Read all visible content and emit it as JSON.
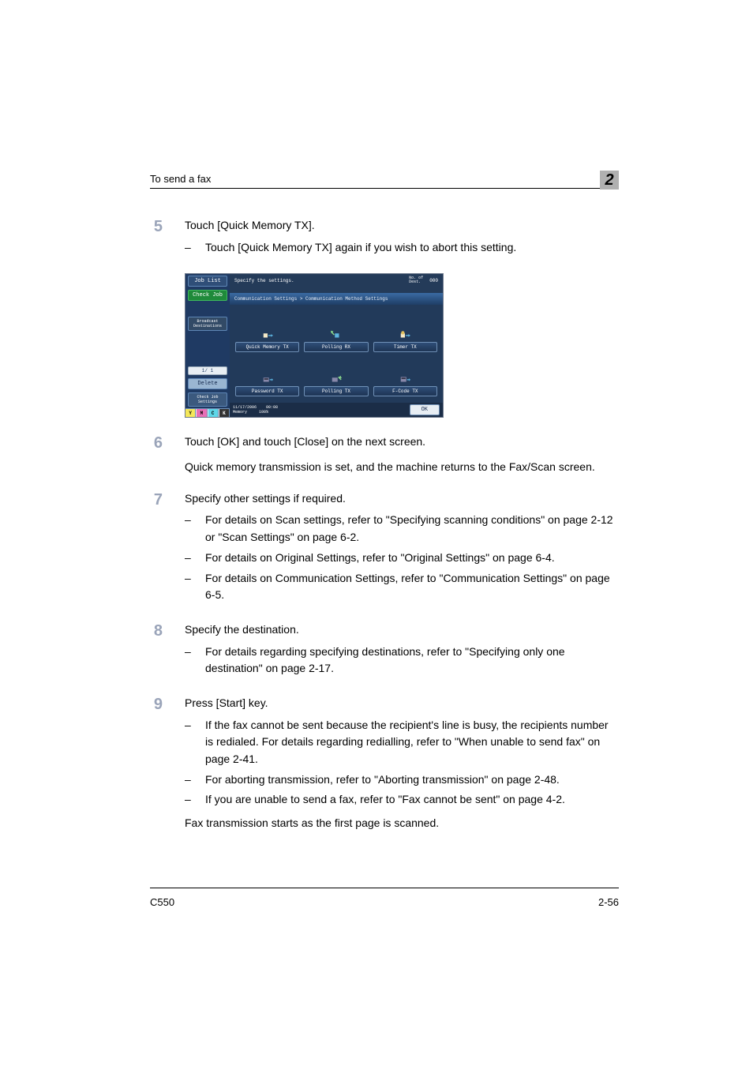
{
  "header": {
    "title": "To send a fax",
    "chapter": "2"
  },
  "footer": {
    "model": "C550",
    "page": "2-56"
  },
  "steps": [
    {
      "n": "5",
      "text": "Touch [Quick Memory TX].",
      "bullets": [
        "Touch [Quick Memory TX] again if you wish to abort this setting."
      ]
    },
    {
      "n": "6",
      "text": "Touch [OK] and touch [Close] on the next screen.",
      "para2": "Quick memory transmission is set, and the machine returns to the Fax/Scan screen."
    },
    {
      "n": "7",
      "text": "Specify other settings if required.",
      "bullets": [
        "For details on Scan settings, refer to \"Specifying scanning conditions\" on page 2-12 or \"Scan Settings\" on page 6-2.",
        "For details on Original Settings, refer to \"Original Settings\" on page 6-4.",
        "For details on Communication Settings, refer to \"Communication Settings\" on page 6-5."
      ]
    },
    {
      "n": "8",
      "text": "Specify the destination.",
      "bullets": [
        "For details regarding specifying destinations, refer to \"Specifying only one destination\" on page 2-17."
      ]
    },
    {
      "n": "9",
      "text": "Press [Start] key.",
      "bullets": [
        "If the fax cannot be sent because the recipient's line is busy, the recipients number is redialed. For details regarding redialling, refer to \"When unable to send fax\" on page 2-41.",
        "For aborting transmission, refer to \"Aborting transmission\" on page 2-48.",
        "If you are unable to send a fax, refer to \"Fax cannot be sent\" on page 4-2."
      ],
      "para2": "Fax transmission starts as the first page is scanned."
    }
  ],
  "screen": {
    "titlebar": {
      "left": "Specify the settings.",
      "dest_label": "No. of\nDest.",
      "dest_count": "000"
    },
    "breadcrumb": "Communication Settings > Communication Method Settings",
    "side": {
      "job_list": "Job List",
      "check_job": "Check Job",
      "broadcast": "Broadcast\nDestinations",
      "page": "1/   1",
      "delete": "Delete",
      "check_settings": "Check Job\nSettings"
    },
    "methods": [
      "Quick Memory TX",
      "Polling RX",
      "Timer TX",
      "Password TX",
      "Polling TX",
      "F-Code TX"
    ],
    "ok": "OK",
    "footer": {
      "date": "11/17/2006",
      "time": "00:08",
      "mem_label": "Memory",
      "mem_val": "100%"
    },
    "toner": [
      "Y",
      "M",
      "C",
      "K"
    ]
  }
}
